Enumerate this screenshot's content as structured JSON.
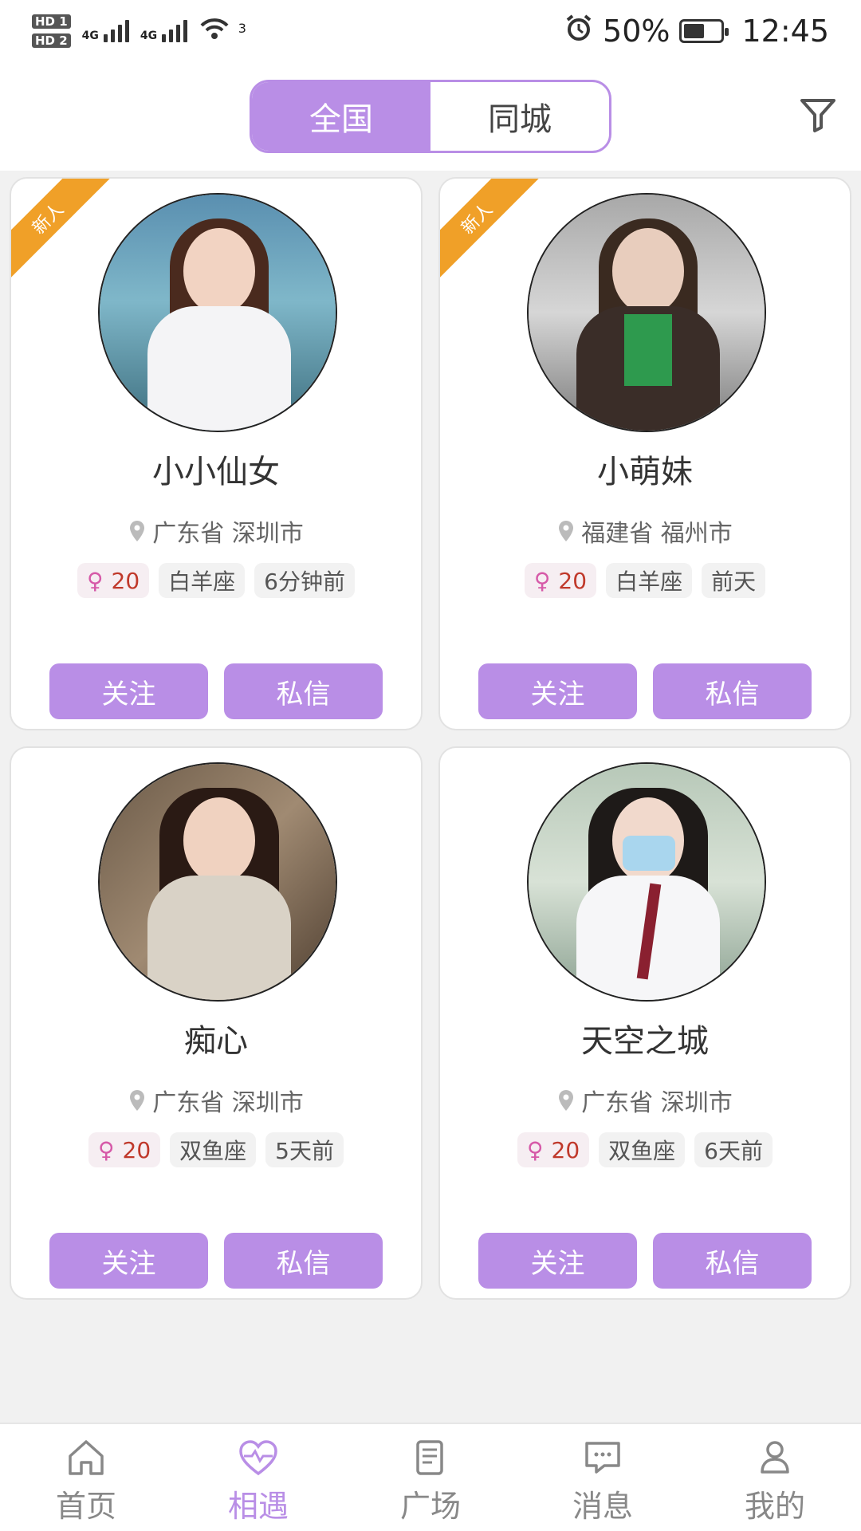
{
  "status": {
    "sim1": "HD 1",
    "sim2": "HD 2",
    "net1": "4G",
    "net2": "4G",
    "wifi_badge": "3",
    "battery": "50%",
    "time": "12:45",
    "icons": [
      "alarm-icon",
      "battery-icon",
      "wifi-icon",
      "signal-icon"
    ]
  },
  "header": {
    "tabs": [
      {
        "label": "全国",
        "active": true
      },
      {
        "label": "同城",
        "active": false
      }
    ],
    "filter_icon": "filter-icon"
  },
  "cards": [
    {
      "name": "小小仙女",
      "location": "广东省 深圳市",
      "age": "20",
      "sign": "白羊座",
      "time": "6分钟前",
      "badge": "新人",
      "follow": "关注",
      "message": "私信"
    },
    {
      "name": "小萌妹",
      "location": "福建省 福州市",
      "age": "20",
      "sign": "白羊座",
      "time": "前天",
      "badge": "新人",
      "follow": "关注",
      "message": "私信"
    },
    {
      "name": "痴心",
      "location": "广东省 深圳市",
      "age": "20",
      "sign": "双鱼座",
      "time": "5天前",
      "badge": "",
      "follow": "关注",
      "message": "私信"
    },
    {
      "name": "天空之城",
      "location": "广东省 深圳市",
      "age": "20",
      "sign": "双鱼座",
      "time": "6天前",
      "badge": "",
      "follow": "关注",
      "message": "私信"
    }
  ],
  "tabbar": {
    "items": [
      {
        "label": "首页",
        "icon": "home-icon",
        "active": false
      },
      {
        "label": "相遇",
        "icon": "heart-pulse-icon",
        "active": true
      },
      {
        "label": "广场",
        "icon": "scroll-icon",
        "active": false
      },
      {
        "label": "消息",
        "icon": "chat-icon",
        "active": false
      },
      {
        "label": "我的",
        "icon": "user-icon",
        "active": false
      }
    ]
  },
  "colors": {
    "accent": "#b98ee6",
    "ribbon": "#f0a028",
    "age_text": "#c0392b"
  }
}
